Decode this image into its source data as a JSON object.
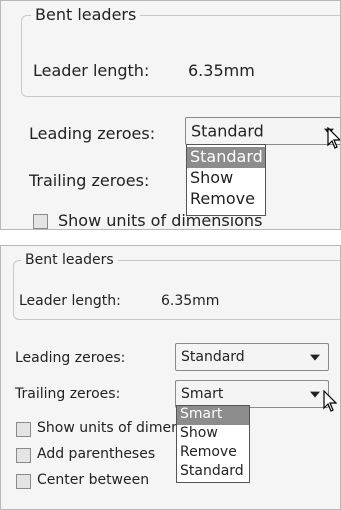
{
  "top_panel": {
    "group_title": "Bent leaders",
    "leader_length_label": "Leader length:",
    "leader_length_value": "6.35mm",
    "leading_zeroes_label": "Leading zeroes:",
    "leading_zeroes_value": "Standard",
    "leading_zeroes_options": [
      "Standard",
      "Show",
      "Remove"
    ],
    "trailing_zeroes_label": "Trailing zeroes:",
    "show_units_label": "Show units of dimensions"
  },
  "bottom_panel": {
    "group_title": "Bent leaders",
    "leader_length_label": "Leader length:",
    "leader_length_value": "6.35mm",
    "leading_zeroes_label": "Leading zeroes:",
    "leading_zeroes_value": "Standard",
    "trailing_zeroes_label": "Trailing zeroes:",
    "trailing_zeroes_value": "Smart",
    "trailing_zeroes_options": [
      "Smart",
      "Show",
      "Remove",
      "Standard"
    ],
    "checkboxes": [
      "Show units of dimensions",
      "Add parentheses",
      "Center between"
    ]
  },
  "colors": {
    "selection": "#8c8c8c",
    "panel_background": "#f5f5f5",
    "separator": "#ffffff"
  },
  "icons": [
    "dropdown-arrow-icon",
    "mouse-pointer-icon",
    "checkbox-icon"
  ]
}
